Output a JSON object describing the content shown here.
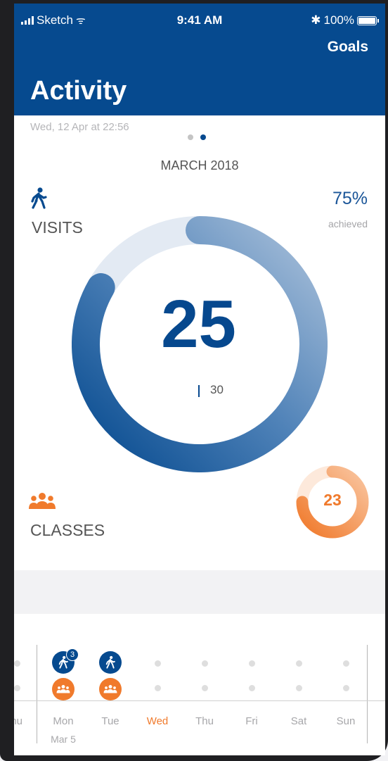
{
  "status_bar": {
    "carrier": "Sketch",
    "time": "9:41 AM",
    "battery": "100%"
  },
  "header": {
    "action": "Goals",
    "title": "Activity"
  },
  "timestamp": "Wed, 12 Apr at 22:56",
  "page_indicator": {
    "count": 2,
    "active_index": 1
  },
  "month": "MARCH 2018",
  "visits": {
    "label": "VISITS",
    "percent": "75%",
    "percent_caption": "achieved",
    "value": "25",
    "goal": "30",
    "progress": 0.8333
  },
  "classes": {
    "label": "CLASSES",
    "value": "23",
    "progress": 0.75
  },
  "calendar": {
    "days": [
      {
        "label": "hu",
        "date": "",
        "visits": 0,
        "classes": 0,
        "today": false
      },
      {
        "label": "Mon",
        "date": "Mar 5",
        "visits": 3,
        "classes": 1,
        "today": false
      },
      {
        "label": "Tue",
        "date": "",
        "visits": 1,
        "classes": 1,
        "today": false
      },
      {
        "label": "Wed",
        "date": "",
        "visits": 0,
        "classes": 0,
        "today": true
      },
      {
        "label": "Thu",
        "date": "",
        "visits": 0,
        "classes": 0,
        "today": false
      },
      {
        "label": "Fri",
        "date": "",
        "visits": 0,
        "classes": 0,
        "today": false
      },
      {
        "label": "Sat",
        "date": "",
        "visits": 0,
        "classes": 0,
        "today": false
      },
      {
        "label": "Sun",
        "date": "",
        "visits": 0,
        "classes": 0,
        "today": false
      }
    ]
  },
  "colors": {
    "brand_blue": "#064a8f",
    "accent_orange": "#f07a2c",
    "track_blue": "#e3eaf3",
    "track_orange": "#fde9db"
  },
  "icons": {
    "visits": "walking-person-icon",
    "classes": "group-icon",
    "signal": "signal-bars-icon",
    "wifi": "wifi-icon",
    "bluetooth": "bluetooth-icon",
    "battery": "battery-icon"
  }
}
